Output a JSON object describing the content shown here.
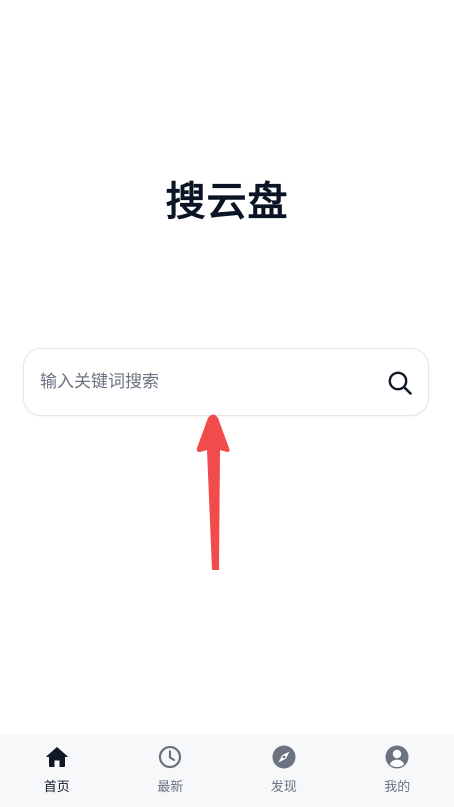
{
  "app": {
    "title": "搜云盘"
  },
  "search": {
    "placeholder": "输入关键词搜索",
    "value": "",
    "button_icon": "search-icon"
  },
  "annotation": {
    "arrow_color": "#f24b4b",
    "arrow_direction": "up"
  },
  "tabbar": {
    "items": [
      {
        "label": "首页",
        "icon": "home-icon",
        "active": true
      },
      {
        "label": "最新",
        "icon": "clock-icon",
        "active": false
      },
      {
        "label": "发现",
        "icon": "compass-icon",
        "active": false
      },
      {
        "label": "我的",
        "icon": "user-circle-icon",
        "active": false
      }
    ],
    "active_color": "#111827",
    "inactive_color": "#6b7280"
  }
}
